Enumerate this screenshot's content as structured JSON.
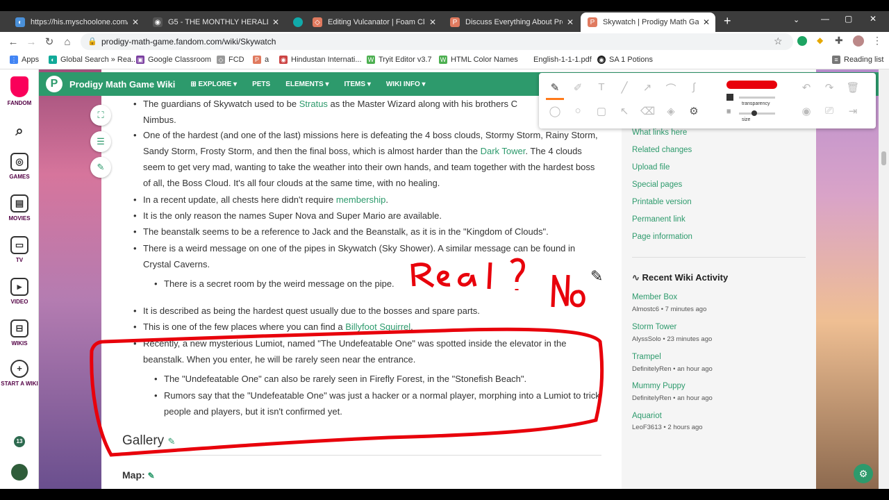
{
  "tabs": [
    {
      "title": "https://his.myschoolone.com/Ap",
      "color": "#4a90d9",
      "icon": "globe-icon"
    },
    {
      "title": "G5 - THE MONTHLY HERALD - SU",
      "color": "#555",
      "icon": "globe-icon"
    },
    {
      "title": "",
      "color": "#1aa",
      "icon": "circle-icon"
    },
    {
      "title": "Editing Vulcanator | Foam Clay D",
      "color": "#e07a5f",
      "icon": "fandom-icon"
    },
    {
      "title": "Discuss Everything About Prodig",
      "color": "#e07a5f",
      "icon": "fandom-icon"
    },
    {
      "title": "Skywatch | Prodigy Math Game V",
      "color": "#e07a5f",
      "icon": "fandom-icon"
    }
  ],
  "address": {
    "url": "prodigy-math-game.fandom.com/wiki/Skywatch"
  },
  "bookmarks": [
    "Apps",
    "Global Search » Rea...",
    "Google Classroom",
    "FCD",
    "a",
    "Hindustan Internati...",
    "Tryit Editor v3.7",
    "HTML Color Names",
    "English-1-1-1.pdf",
    "SA 1 Potions",
    "Reading list"
  ],
  "rail": {
    "fandom": "FANDOM",
    "games": "GAMES",
    "movies": "MOVIES",
    "tv": "TV",
    "video": "VIDEO",
    "wikis": "WIKIS",
    "start": "START A WIKI",
    "badge": "13"
  },
  "wiki": {
    "name": "Prodigy Math Game Wiki",
    "nav": [
      "EXPLORE",
      "PETS",
      "ELEMENTS",
      "ITEMS",
      "WIKI INFO"
    ]
  },
  "content": {
    "b1a": "The guardians of Skywatch used to be ",
    "b1link": "Stratus",
    "b1b": " as the Master Wizard along with his brothers C",
    "b1c": "Nimbus.",
    "b2a": "One of the hardest (and one of the last) missions here is defeating the 4 boss clouds, Stormy Storm, Rainy Storm, Sandy Storm, Frosty Storm, and then the final boss, which is almost harder than the ",
    "b2link": "Dark Tower",
    "b2b": ". The 4 clouds seem to get very mad, wanting to take the weather into their own hands, and team together with the hardest boss of all, the Boss Cloud. It's all four clouds at the same time, with no healing.",
    "b3a": "In a recent update, all chests here didn't require ",
    "b3link": "membership",
    "b3b": ".",
    "b4": "It is the only reason the names Super Nova and Super Mario are available.",
    "b5": "The beanstalk seems to be a reference to Jack and the Beanstalk, as it is in the \"Kingdom of Clouds\".",
    "b6": "There is a weird message on one of the pipes in Skywatch (Sky Shower). A similar message can be found in Crystal Caverns.",
    "b6s": "There is a secret room by the weird message on the pipe.",
    "b7": "It is described as being the hardest quest usually due to the bosses and spare parts.",
    "b8a": "This is one of the few places where you can find a ",
    "b8link": "Billyfoot Squirrel",
    "b8b": ".",
    "b9": "Recently, a new mysterious Lumiot, named \"The Undefeatable One\" was spotted inside the elevator in the beanstalk. When you enter, he will be rarely seen near the entrance.",
    "b9s1": "The \"Undefeatable One\" can also be rarely seen in Firefly Forest, in the \"Stonefish Beach\".",
    "b9s2": "Rumors say that the \"Undefeatable One\" was just a hacker or a normal player, morphing into a Lumiot to trick people and players, but it isn't confirmed yet.",
    "gallery": "Gallery",
    "map": "Map:"
  },
  "tools": [
    "What links here",
    "Related changes",
    "Upload file",
    "Special pages",
    "Printable version",
    "Permanent link",
    "Page information"
  ],
  "activity": {
    "title": "Recent Wiki Activity",
    "items": [
      {
        "page": "Member Box",
        "meta": "Almostc6 • 7 minutes ago"
      },
      {
        "page": "Storm Tower",
        "meta": "AlyssSolo • 23 minutes ago"
      },
      {
        "page": "Trampel",
        "meta": "DefinitelyRen • an hour ago"
      },
      {
        "page": "Mummy Puppy",
        "meta": "DefinitelyRen • an hour ago"
      },
      {
        "page": "Aquariot",
        "meta": "LeoF3613 • 2 hours ago"
      }
    ]
  },
  "annot": {
    "transparency": "transparency",
    "size": "size",
    "color": "#e8000b"
  },
  "handwriting": {
    "real": "Real?",
    "no": "No"
  }
}
